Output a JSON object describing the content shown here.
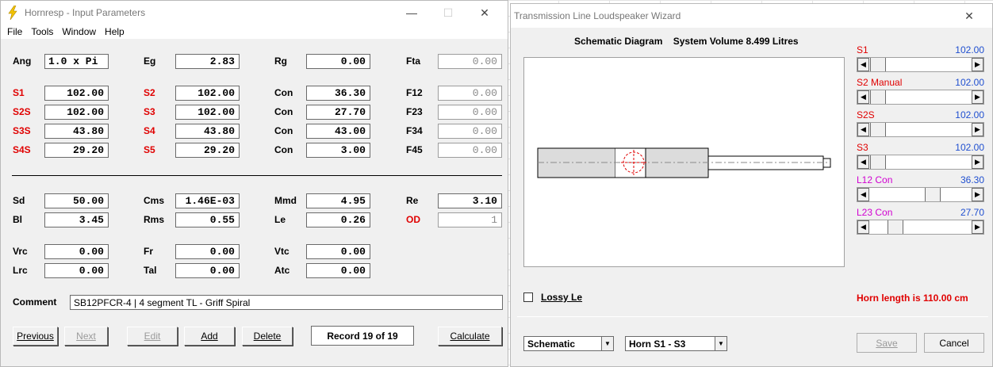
{
  "input_window": {
    "title": "Hornresp - Input Parameters",
    "menu": [
      "File",
      "Tools",
      "Window",
      "Help"
    ],
    "row1": [
      {
        "label": "Ang",
        "value": "1.0 x Pi"
      },
      {
        "label": "Eg",
        "value": "2.83"
      },
      {
        "label": "Rg",
        "value": "0.00"
      },
      {
        "label": "Fta",
        "value": "0.00"
      }
    ],
    "segments": [
      [
        {
          "label": "S1",
          "value": "102.00"
        },
        {
          "label": "S2",
          "value": "102.00"
        },
        {
          "label": "Con",
          "value": "36.30"
        },
        {
          "label": "F12",
          "value": "0.00"
        }
      ],
      [
        {
          "label": "S2S",
          "value": "102.00"
        },
        {
          "label": "S3",
          "value": "102.00"
        },
        {
          "label": "Con",
          "value": "27.70"
        },
        {
          "label": "F23",
          "value": "0.00"
        }
      ],
      [
        {
          "label": "S3S",
          "value": "43.80"
        },
        {
          "label": "S4",
          "value": "43.80"
        },
        {
          "label": "Con",
          "value": "43.00"
        },
        {
          "label": "F34",
          "value": "0.00"
        }
      ],
      [
        {
          "label": "S4S",
          "value": "29.20"
        },
        {
          "label": "S5",
          "value": "29.20"
        },
        {
          "label": "Con",
          "value": "3.00"
        },
        {
          "label": "F45",
          "value": "0.00"
        }
      ]
    ],
    "driver": [
      [
        {
          "label": "Sd",
          "value": "50.00"
        },
        {
          "label": "Cms",
          "value": "1.46E-03"
        },
        {
          "label": "Mmd",
          "value": "4.95"
        },
        {
          "label": "Re",
          "value": "3.10"
        }
      ],
      [
        {
          "label": "Bl",
          "value": "3.45"
        },
        {
          "label": "Rms",
          "value": "0.55"
        },
        {
          "label": "Le",
          "value": "0.26"
        },
        {
          "label": "OD",
          "value": "1"
        }
      ]
    ],
    "chamber": [
      [
        {
          "label": "Vrc",
          "value": "0.00"
        },
        {
          "label": "Fr",
          "value": "0.00"
        },
        {
          "label": "Vtc",
          "value": "0.00"
        }
      ],
      [
        {
          "label": "Lrc",
          "value": "0.00"
        },
        {
          "label": "Tal",
          "value": "0.00"
        },
        {
          "label": "Atc",
          "value": "0.00"
        }
      ]
    ],
    "comment_label": "Comment",
    "comment": "SB12PFCR-4 | 4 segment TL -  Griff Spiral",
    "buttons": {
      "previous": "Previous",
      "next": "Next",
      "edit": "Edit",
      "add": "Add",
      "delete": "Delete",
      "calculate": "Calculate"
    },
    "record": "Record 19 of 19",
    "red_color": "#e00000"
  },
  "wizard_window": {
    "title": "Transmission Line Loudspeaker Wizard",
    "schematic_title": "Schematic Diagram",
    "system_volume": "System Volume 8.499 Litres",
    "sliders": [
      {
        "label": "S1",
        "value": "102.00",
        "color": "#e00000",
        "position": 0.08
      },
      {
        "label": "S2  Manual",
        "value": "102.00",
        "color": "#e00000",
        "position": 0.08
      },
      {
        "label": "S2S",
        "value": "102.00",
        "color": "#e00000",
        "position": 0.08
      },
      {
        "label": "S3",
        "value": "102.00",
        "color": "#e00000",
        "position": 0.08
      },
      {
        "label": "L12  Con",
        "value": "36.30",
        "color": "#d100d1",
        "position": 0.58
      },
      {
        "label": "L23  Con",
        "value": "27.70",
        "color": "#d100d1",
        "position": 0.26
      }
    ],
    "lossy_le": "Lossy Le",
    "horn_length": "Horn length is 110.00 cm",
    "combo1": "Schematic",
    "combo2": "Horn S1 - S3",
    "save": "Save",
    "cancel": "Cancel",
    "value_color": "#1f4fd0"
  }
}
